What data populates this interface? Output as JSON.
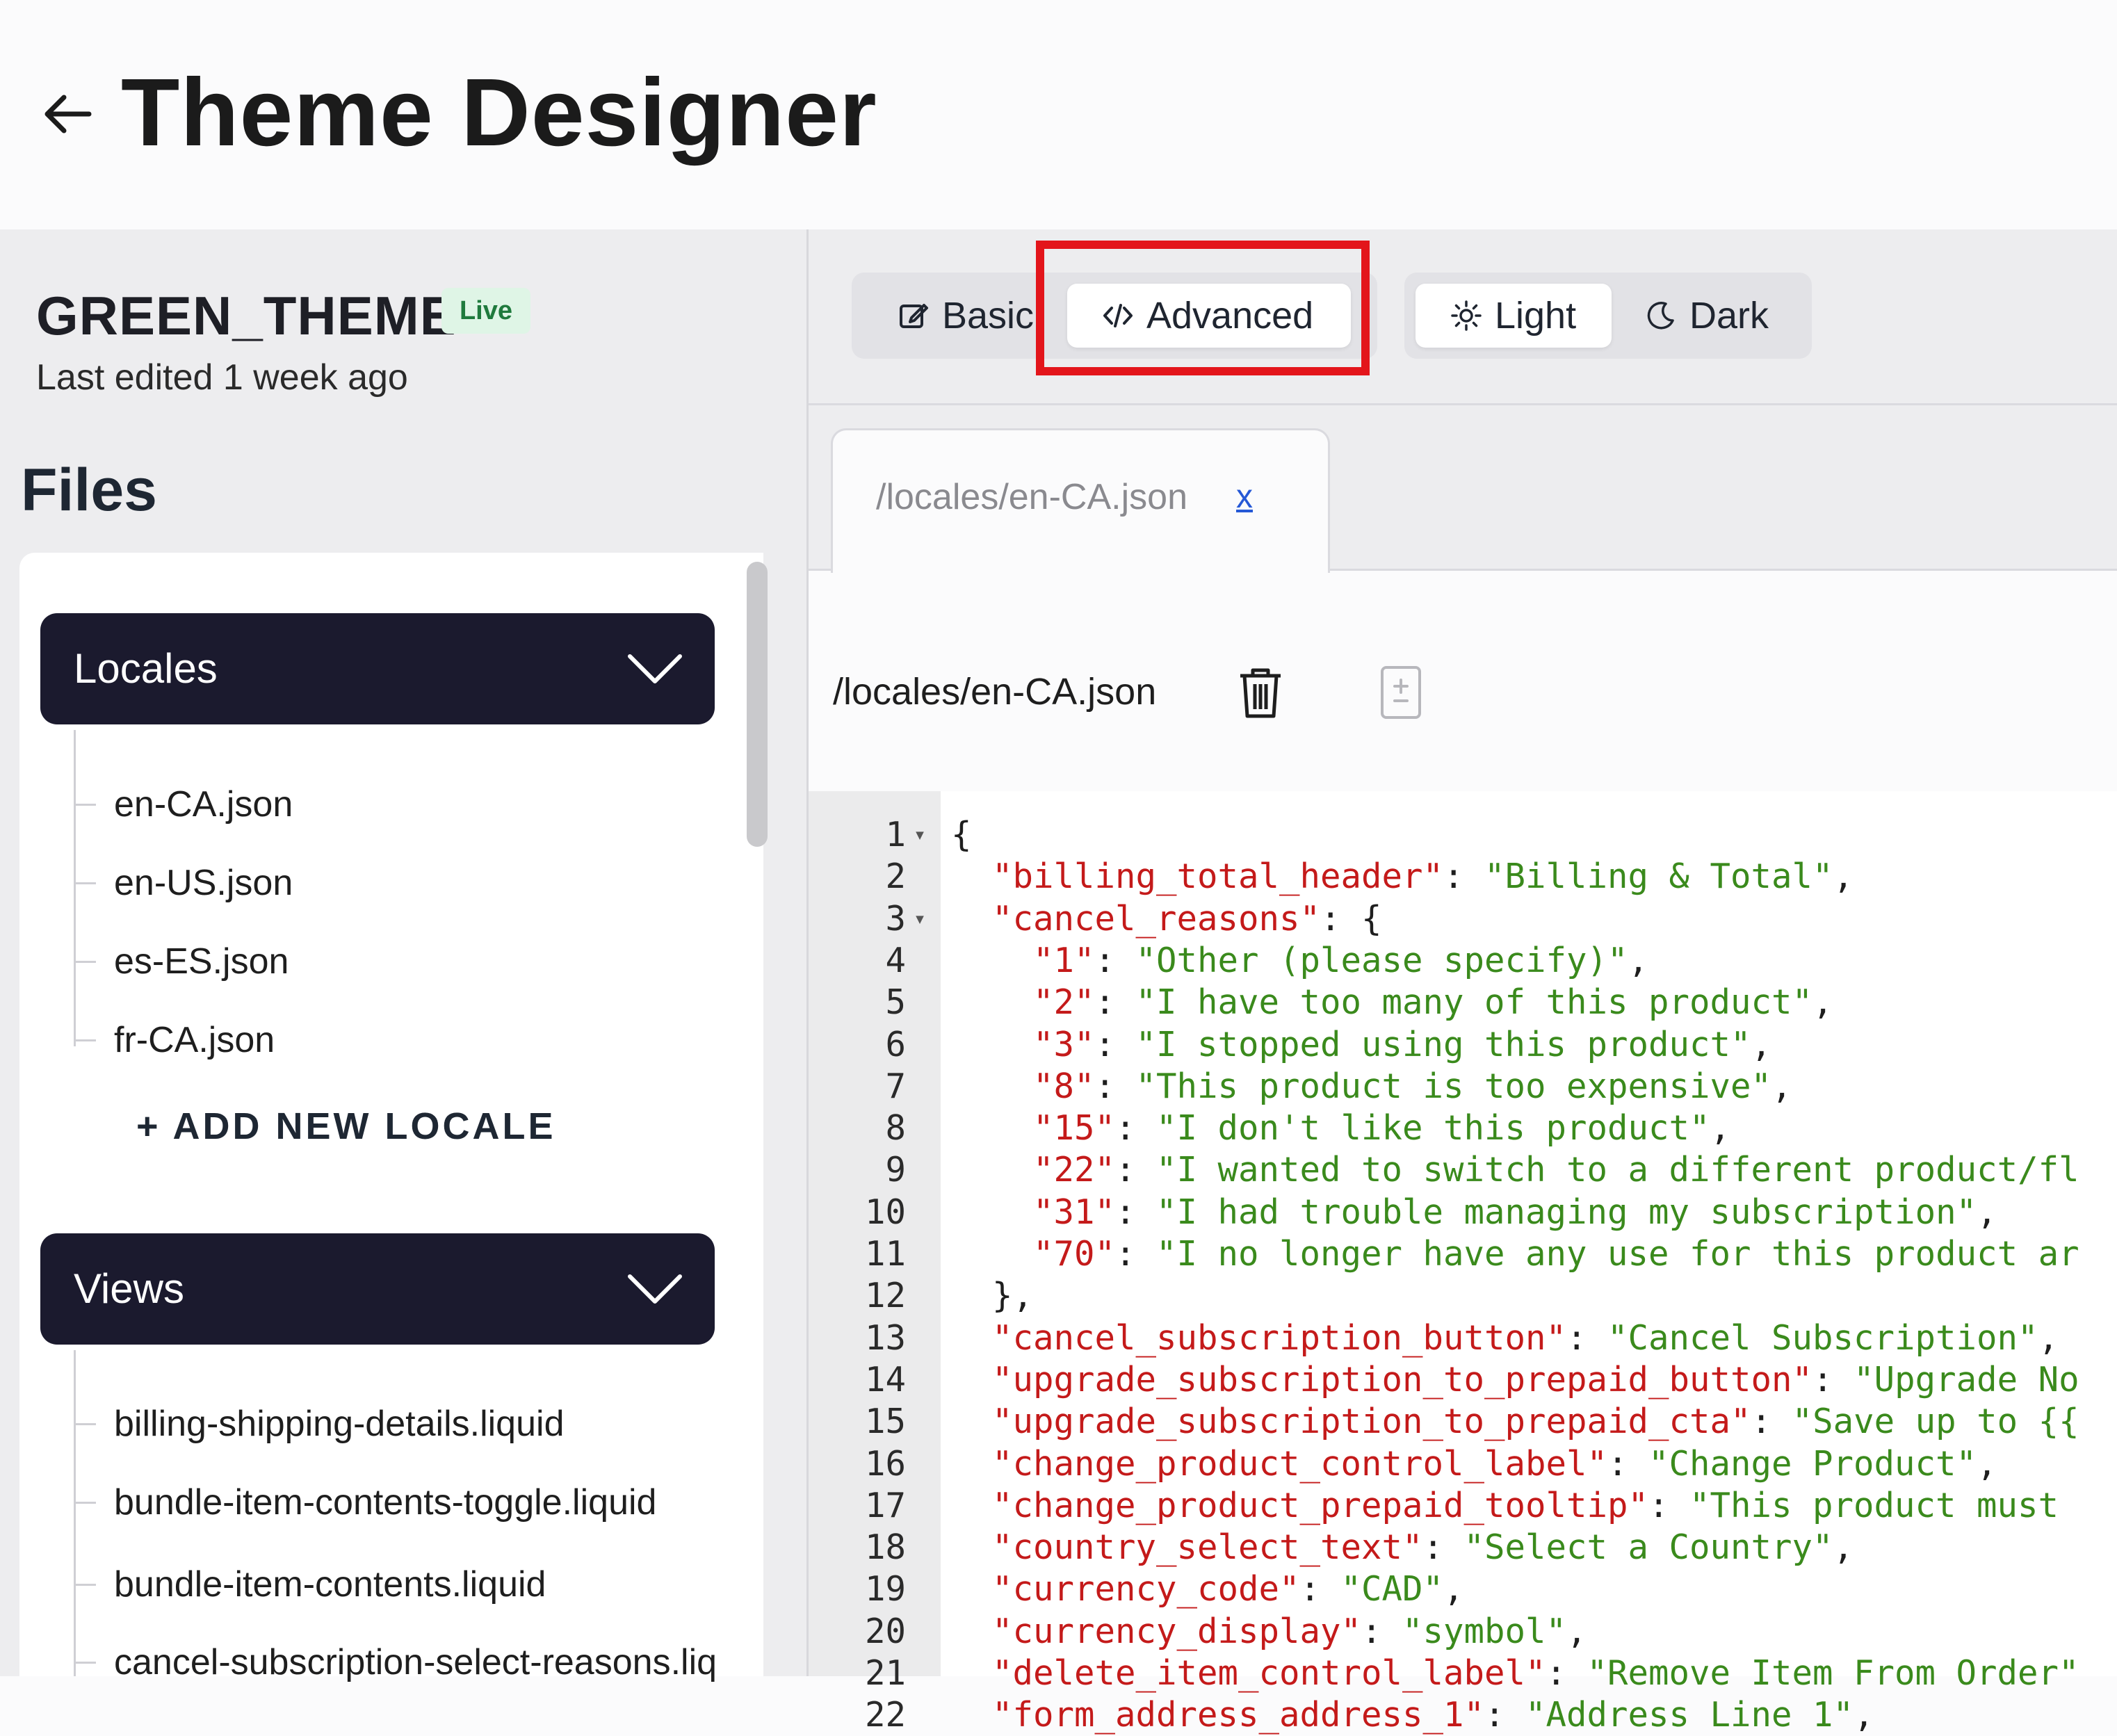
{
  "header": {
    "title": "Theme Designer",
    "back_icon": "arrow-left-icon"
  },
  "sidebar": {
    "theme_name": "GREEN_THEME",
    "status_badge": "Live",
    "last_edited": "Last edited 1 week ago",
    "files_heading": "Files",
    "sections": [
      {
        "label": "Locales",
        "expanded": true,
        "items": [
          "en-CA.json",
          "en-US.json",
          "es-ES.json",
          "fr-CA.json"
        ],
        "add_label": "+ ADD NEW LOCALE"
      },
      {
        "label": "Views",
        "expanded": true,
        "items": [
          "billing-shipping-details.liquid",
          "bundle-item-contents-toggle.liquid",
          "bundle-item-contents.liquid",
          "cancel-subscription-select-reasons.liq"
        ]
      }
    ]
  },
  "toolbar": {
    "mode_toggle": [
      {
        "label": "Basic",
        "icon": "edit-icon",
        "active": false
      },
      {
        "label": "Advanced",
        "icon": "code-icon",
        "active": true
      }
    ],
    "theme_toggle": [
      {
        "label": "Light",
        "icon": "sun-icon",
        "active": true
      },
      {
        "label": "Dark",
        "icon": "moon-icon",
        "active": false
      }
    ],
    "highlight_color": "#e3151b"
  },
  "editor": {
    "open_tab": {
      "name": "/locales/en-CA.json",
      "close": "x"
    },
    "file_path": "/locales/en-CA.json",
    "actions": [
      "trash-icon",
      "diff-icon"
    ],
    "lines": [
      {
        "n": "1",
        "fold": true,
        "parts": [
          [
            "p",
            "{"
          ]
        ]
      },
      {
        "n": "2",
        "parts": [
          [
            "p",
            "  "
          ],
          [
            "k",
            "\"billing_total_header\""
          ],
          [
            "p",
            ": "
          ],
          [
            "s",
            "\"Billing & Total\""
          ],
          [
            "p",
            ","
          ]
        ]
      },
      {
        "n": "3",
        "fold": true,
        "parts": [
          [
            "p",
            "  "
          ],
          [
            "k",
            "\"cancel_reasons\""
          ],
          [
            "p",
            ": {"
          ]
        ]
      },
      {
        "n": "4",
        "parts": [
          [
            "p",
            "    "
          ],
          [
            "k",
            "\"1\""
          ],
          [
            "p",
            ": "
          ],
          [
            "s",
            "\"Other (please specify)\""
          ],
          [
            "p",
            ","
          ]
        ]
      },
      {
        "n": "5",
        "parts": [
          [
            "p",
            "    "
          ],
          [
            "k",
            "\"2\""
          ],
          [
            "p",
            ": "
          ],
          [
            "s",
            "\"I have too many of this product\""
          ],
          [
            "p",
            ","
          ]
        ]
      },
      {
        "n": "6",
        "parts": [
          [
            "p",
            "    "
          ],
          [
            "k",
            "\"3\""
          ],
          [
            "p",
            ": "
          ],
          [
            "s",
            "\"I stopped using this product\""
          ],
          [
            "p",
            ","
          ]
        ]
      },
      {
        "n": "7",
        "parts": [
          [
            "p",
            "    "
          ],
          [
            "k",
            "\"8\""
          ],
          [
            "p",
            ": "
          ],
          [
            "s",
            "\"This product is too expensive\""
          ],
          [
            "p",
            ","
          ]
        ]
      },
      {
        "n": "8",
        "parts": [
          [
            "p",
            "    "
          ],
          [
            "k",
            "\"15\""
          ],
          [
            "p",
            ": "
          ],
          [
            "s",
            "\"I don't like this product\""
          ],
          [
            "p",
            ","
          ]
        ]
      },
      {
        "n": "9",
        "parts": [
          [
            "p",
            "    "
          ],
          [
            "k",
            "\"22\""
          ],
          [
            "p",
            ": "
          ],
          [
            "s",
            "\"I wanted to switch to a different product/fl"
          ]
        ]
      },
      {
        "n": "10",
        "parts": [
          [
            "p",
            "    "
          ],
          [
            "k",
            "\"31\""
          ],
          [
            "p",
            ": "
          ],
          [
            "s",
            "\"I had trouble managing my subscription\""
          ],
          [
            "p",
            ","
          ]
        ]
      },
      {
        "n": "11",
        "parts": [
          [
            "p",
            "    "
          ],
          [
            "k",
            "\"70\""
          ],
          [
            "p",
            ": "
          ],
          [
            "s",
            "\"I no longer have any use for this product ar"
          ]
        ]
      },
      {
        "n": "12",
        "parts": [
          [
            "p",
            "  },"
          ]
        ]
      },
      {
        "n": "13",
        "parts": [
          [
            "p",
            "  "
          ],
          [
            "k",
            "\"cancel_subscription_button\""
          ],
          [
            "p",
            ": "
          ],
          [
            "s",
            "\"Cancel Subscription\""
          ],
          [
            "p",
            ","
          ]
        ]
      },
      {
        "n": "14",
        "parts": [
          [
            "p",
            "  "
          ],
          [
            "k",
            "\"upgrade_subscription_to_prepaid_button\""
          ],
          [
            "p",
            ": "
          ],
          [
            "s",
            "\"Upgrade No"
          ]
        ]
      },
      {
        "n": "15",
        "parts": [
          [
            "p",
            "  "
          ],
          [
            "k",
            "\"upgrade_subscription_to_prepaid_cta\""
          ],
          [
            "p",
            ": "
          ],
          [
            "s",
            "\"Save up to {{"
          ]
        ]
      },
      {
        "n": "16",
        "parts": [
          [
            "p",
            "  "
          ],
          [
            "k",
            "\"change_product_control_label\""
          ],
          [
            "p",
            ": "
          ],
          [
            "s",
            "\"Change Product\""
          ],
          [
            "p",
            ","
          ]
        ]
      },
      {
        "n": "17",
        "parts": [
          [
            "p",
            "  "
          ],
          [
            "k",
            "\"change_product_prepaid_tooltip\""
          ],
          [
            "p",
            ": "
          ],
          [
            "s",
            "\"This product must"
          ]
        ]
      },
      {
        "n": "18",
        "parts": [
          [
            "p",
            "  "
          ],
          [
            "k",
            "\"country_select_text\""
          ],
          [
            "p",
            ": "
          ],
          [
            "s",
            "\"Select a Country\""
          ],
          [
            "p",
            ","
          ]
        ]
      },
      {
        "n": "19",
        "parts": [
          [
            "p",
            "  "
          ],
          [
            "k",
            "\"currency_code\""
          ],
          [
            "p",
            ": "
          ],
          [
            "s",
            "\"CAD\""
          ],
          [
            "p",
            ","
          ]
        ]
      },
      {
        "n": "20",
        "parts": [
          [
            "p",
            "  "
          ],
          [
            "k",
            "\"currency_display\""
          ],
          [
            "p",
            ": "
          ],
          [
            "s",
            "\"symbol\""
          ],
          [
            "p",
            ","
          ]
        ]
      },
      {
        "n": "21",
        "parts": [
          [
            "p",
            "  "
          ],
          [
            "k",
            "\"delete_item_control_label\""
          ],
          [
            "p",
            ": "
          ],
          [
            "s",
            "\"Remove Item From Order\""
          ]
        ]
      },
      {
        "n": "22",
        "parts": [
          [
            "p",
            "  "
          ],
          [
            "k",
            "\"form_address_address_1\""
          ],
          [
            "p",
            ": "
          ],
          [
            "s",
            "\"Address Line 1\""
          ],
          [
            "p",
            ","
          ]
        ]
      }
    ]
  }
}
